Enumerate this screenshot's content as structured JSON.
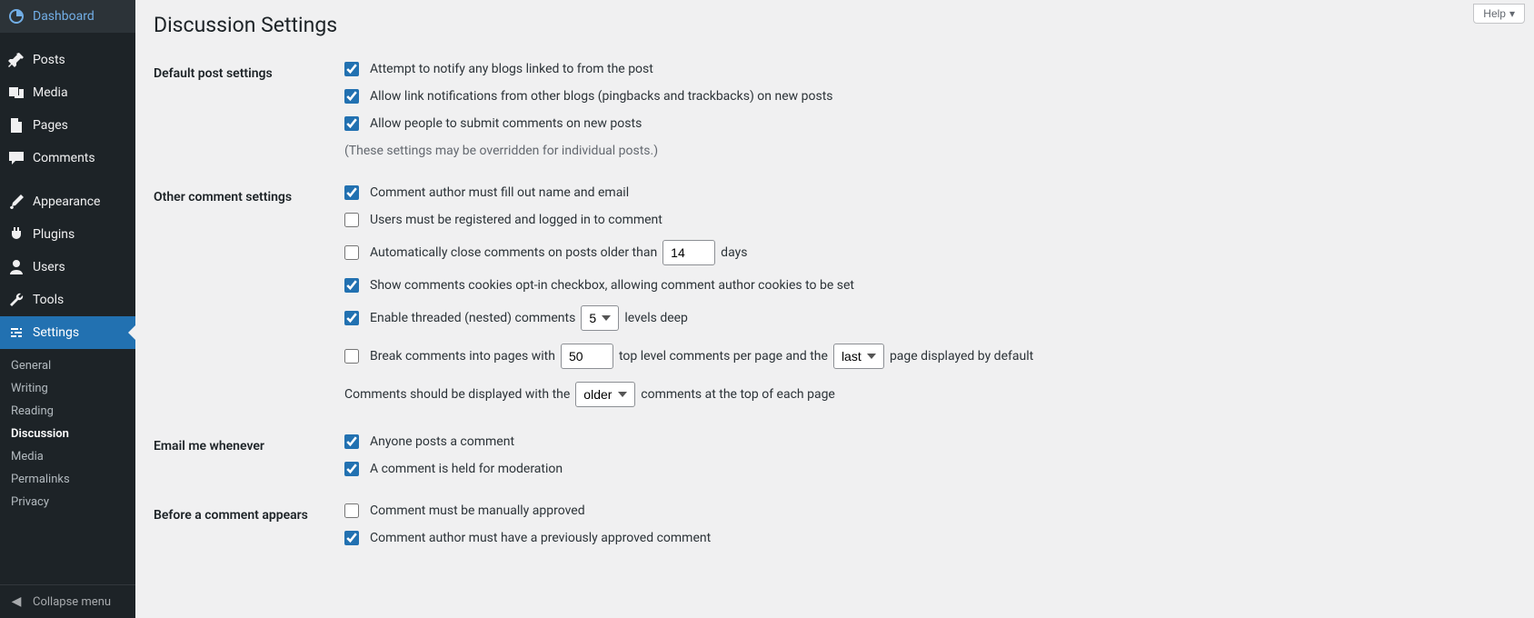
{
  "sidebar": {
    "items": [
      {
        "icon": "dashboard",
        "label": "Dashboard"
      },
      {
        "icon": "posts",
        "label": "Posts"
      },
      {
        "icon": "media",
        "label": "Media"
      },
      {
        "icon": "pages",
        "label": "Pages"
      },
      {
        "icon": "comments",
        "label": "Comments"
      },
      {
        "icon": "appearance",
        "label": "Appearance"
      },
      {
        "icon": "plugins",
        "label": "Plugins"
      },
      {
        "icon": "users",
        "label": "Users"
      },
      {
        "icon": "tools",
        "label": "Tools"
      },
      {
        "icon": "settings",
        "label": "Settings"
      }
    ],
    "submenu": [
      {
        "label": "General"
      },
      {
        "label": "Writing"
      },
      {
        "label": "Reading"
      },
      {
        "label": "Discussion"
      },
      {
        "label": "Media"
      },
      {
        "label": "Permalinks"
      },
      {
        "label": "Privacy"
      }
    ],
    "collapse_label": "Collapse menu"
  },
  "header": {
    "help_label": "Help",
    "page_title": "Discussion Settings"
  },
  "sections": {
    "default_post": {
      "heading": "Default post settings",
      "opt1": "Attempt to notify any blogs linked to from the post",
      "opt2": "Allow link notifications from other blogs (pingbacks and trackbacks) on new posts",
      "opt3": "Allow people to submit comments on new posts",
      "note": "(These settings may be overridden for individual posts.)"
    },
    "other_comment": {
      "heading": "Other comment settings",
      "opt1": "Comment author must fill out name and email",
      "opt2": "Users must be registered and logged in to comment",
      "opt3_pre": "Automatically close comments on posts older than",
      "opt3_days_value": "14",
      "opt3_post": "days",
      "opt4": "Show comments cookies opt-in checkbox, allowing comment author cookies to be set",
      "opt5_pre": "Enable threaded (nested) comments",
      "opt5_levels_value": "5",
      "opt5_post": "levels deep",
      "opt6_pre": "Break comments into pages with",
      "opt6_perpage_value": "50",
      "opt6_mid": "top level comments per page and the",
      "opt6_page_default": "last",
      "opt6_post": "page displayed by default",
      "opt7_pre": "Comments should be displayed with the",
      "opt7_order": "older",
      "opt7_post": "comments at the top of each page"
    },
    "email_me": {
      "heading": "Email me whenever",
      "opt1": "Anyone posts a comment",
      "opt2": "A comment is held for moderation"
    },
    "before_appears": {
      "heading": "Before a comment appears",
      "opt1": "Comment must be manually approved",
      "opt2": "Comment author must have a previously approved comment"
    }
  }
}
